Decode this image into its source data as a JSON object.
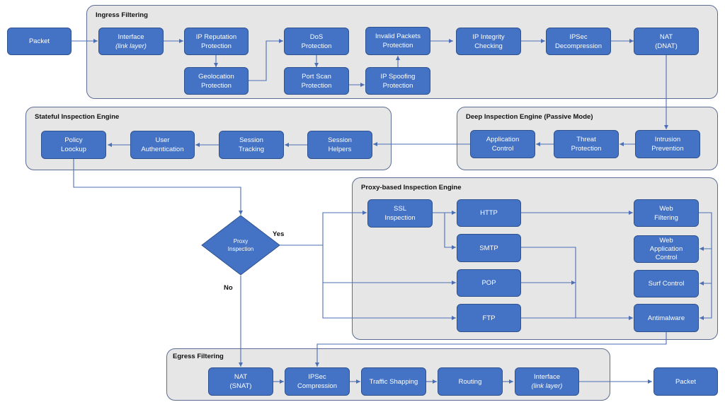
{
  "groups": {
    "ingress": "Ingress Filtering",
    "stateful": "Stateful Inspection Engine",
    "deep": "Deep Inspection Engine (Passive Mode)",
    "proxy": "Proxy-based Inspection Engine",
    "egress": "Egress Filtering"
  },
  "nodes": {
    "packet_in": [
      "Packet"
    ],
    "iface_in": [
      "Interface",
      "(link layer)"
    ],
    "ip_rep": [
      "IP Reputation",
      "Protection"
    ],
    "geo": [
      "Geolocation",
      "Protection"
    ],
    "dos": [
      "DoS",
      "Protection"
    ],
    "portscan": [
      "Port Scan",
      "Protection"
    ],
    "invalid": [
      "Invalid Packets",
      "Protection"
    ],
    "spoof": [
      "IP Spoofing",
      "Protection"
    ],
    "integrity": [
      "IP Integrity",
      "Checking"
    ],
    "ipsec_dec": [
      "IPSec",
      "Decompression"
    ],
    "dnat": [
      "NAT",
      "(DNAT)"
    ],
    "ips": [
      "Intrusion",
      "Prevention"
    ],
    "threat": [
      "Threat",
      "Protection"
    ],
    "appctl": [
      "Application",
      "Control"
    ],
    "helpers": [
      "Session",
      "Helpers"
    ],
    "tracking": [
      "Session",
      "Tracking"
    ],
    "userauth": [
      "User",
      "Authentication"
    ],
    "policy": [
      "Policy",
      "Loockup"
    ],
    "proxy_decision": [
      "Proxy",
      "Inspection"
    ],
    "ssl": [
      "SSL",
      "Inspection"
    ],
    "http": [
      "HTTP"
    ],
    "smtp": [
      "SMTP"
    ],
    "pop": [
      "POP"
    ],
    "ftp": [
      "FTP"
    ],
    "webfilter": [
      "Web",
      "Filtering"
    ],
    "webapp": [
      "Web",
      "Application",
      "Control"
    ],
    "surf": [
      "Surf Control"
    ],
    "antimalware": [
      "Antimalware"
    ],
    "snat": [
      "NAT",
      "(SNAT)"
    ],
    "ipsec_comp": [
      "IPSec",
      "Compression"
    ],
    "shaping": [
      "Traffic Shapping"
    ],
    "routing": [
      "Routing"
    ],
    "iface_out": [
      "Interface",
      "(link layer)"
    ],
    "packet_out": [
      "Packet"
    ]
  },
  "labels": {
    "yes": "Yes",
    "no": "No"
  },
  "colors": {
    "node_fill": "#4472c4",
    "node_border": "#2f528f",
    "group_fill": "#e6e6e6",
    "connector": "#4a6fb5"
  }
}
